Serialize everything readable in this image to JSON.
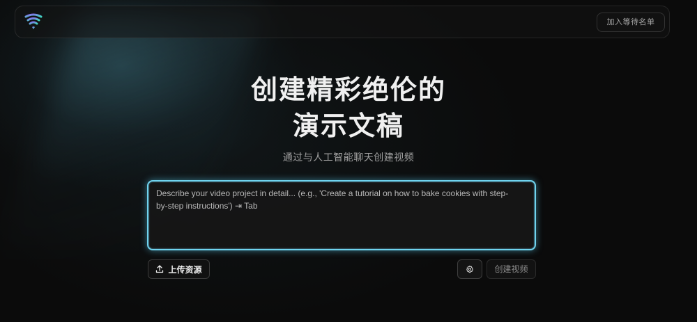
{
  "header": {
    "logo_icon": "wifi-shield-logo-icon",
    "waitlist_label": "加入等待名单"
  },
  "hero": {
    "title_line1": "创建精彩绝伦的",
    "title_line2": "演示文稿",
    "subtitle": "通过与人工智能聊天创建视频"
  },
  "prompt": {
    "placeholder": "Describe your video project in detail... (e.g., 'Create a tutorial on how to bake cookies with step-by-step instructions') ⇥ Tab",
    "value": "",
    "accent_color": "#6fd3ee"
  },
  "actions": {
    "upload_label": "上传资源",
    "upload_icon": "upload-icon",
    "settings_icon": "gear-icon",
    "create_label": "创建视频"
  },
  "colors": {
    "background": "#0b0b0b",
    "logo_gradient_start": "#7a6cf0",
    "logo_gradient_end": "#3fd8c0"
  }
}
